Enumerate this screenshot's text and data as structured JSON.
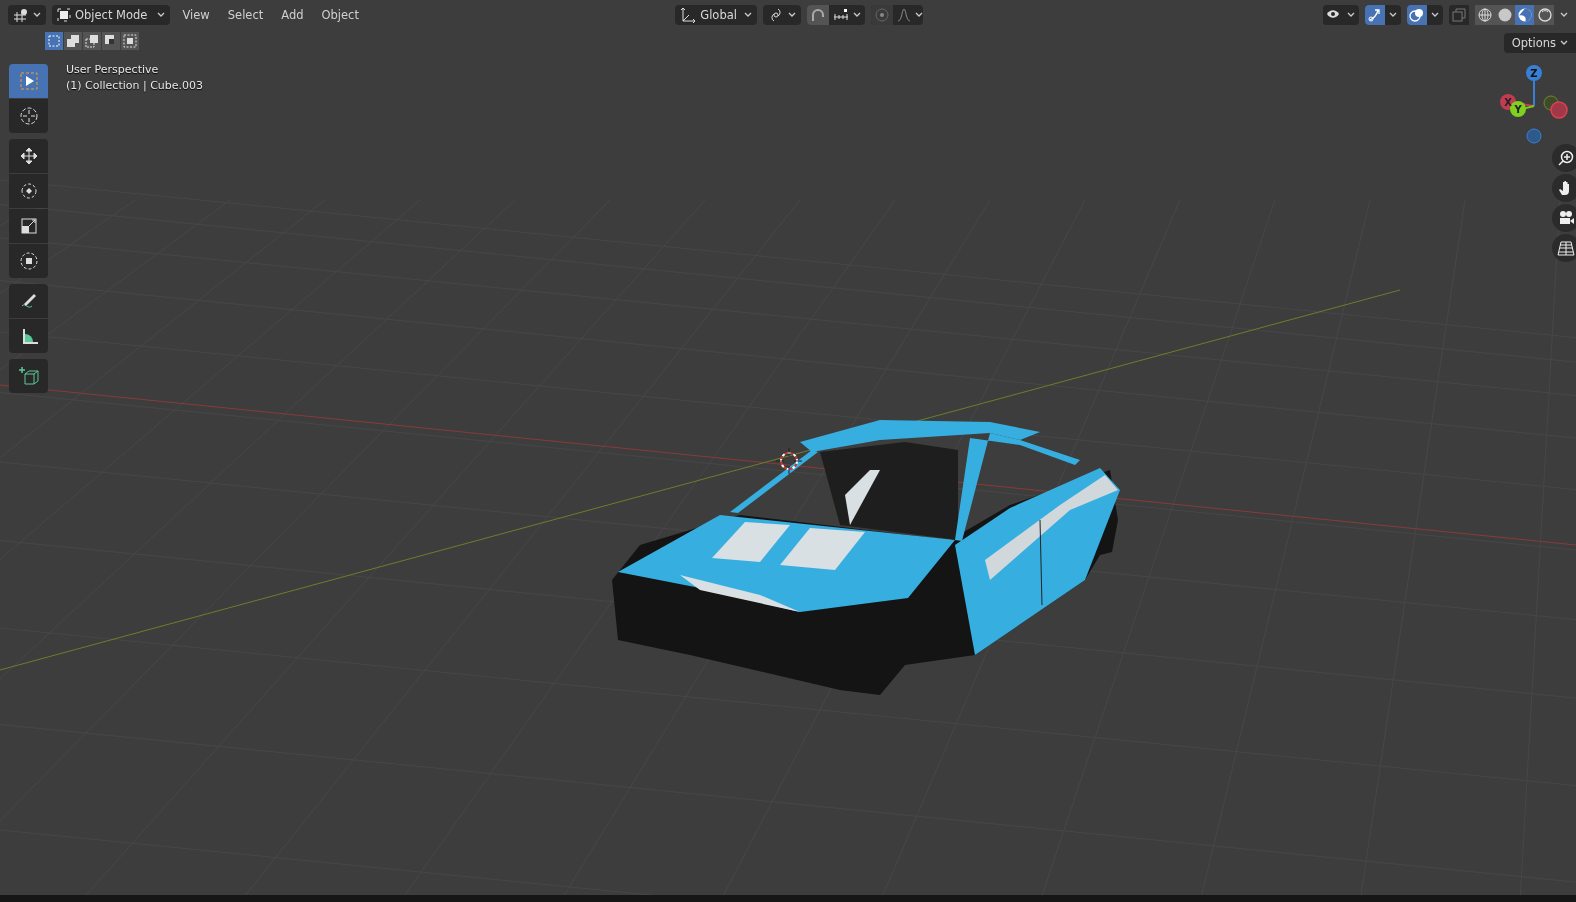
{
  "header": {
    "mode": {
      "label": "Object Mode"
    },
    "menus": [
      "View",
      "Select",
      "Add",
      "Object"
    ],
    "orientation": {
      "label": "Global"
    },
    "toggles": [
      {
        "kind": "visibility",
        "on": false
      },
      {
        "kind": "gizmos",
        "on": true
      },
      {
        "kind": "overlays",
        "on": true
      },
      {
        "kind": "xray",
        "on": false
      }
    ],
    "shading": [
      {
        "kind": "wireframe",
        "selected": false
      },
      {
        "kind": "solid",
        "selected": false
      },
      {
        "kind": "material",
        "selected": true
      },
      {
        "kind": "rendered",
        "selected": false
      }
    ]
  },
  "selection_modes": [
    {
      "kind": "new",
      "selected": true
    },
    {
      "kind": "extend",
      "selected": false
    },
    {
      "kind": "subtract",
      "selected": false
    },
    {
      "kind": "invert",
      "selected": false
    },
    {
      "kind": "intersect",
      "selected": false
    }
  ],
  "options": {
    "label": "Options"
  },
  "viewport_info": {
    "view": "User Perspective",
    "object": "(1) Collection | Cube.003"
  },
  "toolbar": [
    [
      {
        "kind": "select",
        "selected": true
      },
      {
        "kind": "cursor",
        "selected": false
      }
    ],
    [
      {
        "kind": "move",
        "selected": false
      },
      {
        "kind": "rotate",
        "selected": false
      },
      {
        "kind": "scale",
        "selected": false
      },
      {
        "kind": "transform",
        "selected": false
      }
    ],
    [
      {
        "kind": "annotate",
        "selected": false
      },
      {
        "kind": "measure",
        "selected": false
      }
    ],
    [
      {
        "kind": "add_cube",
        "selected": false
      }
    ]
  ],
  "gizmo": {
    "x": "X",
    "y": "Y",
    "z": "Z"
  },
  "navigation": [
    {
      "kind": "zoom"
    },
    {
      "kind": "pan"
    },
    {
      "kind": "camera"
    },
    {
      "kind": "ortho"
    }
  ]
}
